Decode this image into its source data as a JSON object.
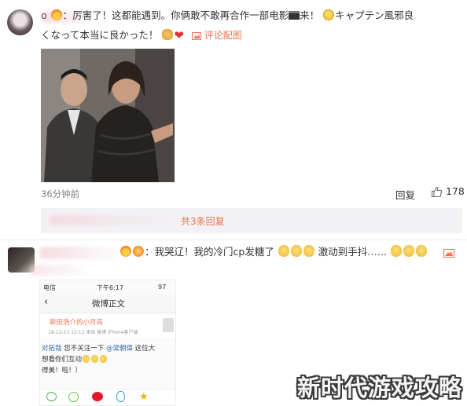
{
  "comment1": {
    "name_tail": "o",
    "text_line1": "：厉害了！这都能遇到。你俩敢不敢再合作一部电影",
    "text_line1_after": "来！",
    "text_line1_end": "キャプテン風邪良",
    "text_line2": "くなって本当に良かった！",
    "view_pic_label": "评论配图",
    "time": "36分钟前",
    "reply_label": "回复",
    "like_count": "178",
    "thread_label": "共3条回复"
  },
  "comment2": {
    "text_prefix": "：",
    "text_part1": "我哭辽！我的冷门cp发糖了",
    "text_part2": "激动到手抖……",
    "phone": {
      "carrier": "电信",
      "clock": "下午6:17",
      "battery": "97",
      "title": "微博正文",
      "user_name": "新田浩介的小月亮",
      "user_time": "18-12-23 12:12  来自 微博 iPhone客户端",
      "body_line1_link": "对拓哉",
      "body_line1": "您不关注一下",
      "body_line1_at": "@梁朝偉",
      "body_line1_end": "这位大",
      "body_line2": "想看你们互动",
      "body_line3": "得美！啦！）"
    }
  },
  "watermark": "新时代游戏攻略",
  "colors": {
    "link": "#eb7350",
    "muted": "#808080",
    "reply_bg": "#f2f2f5"
  }
}
